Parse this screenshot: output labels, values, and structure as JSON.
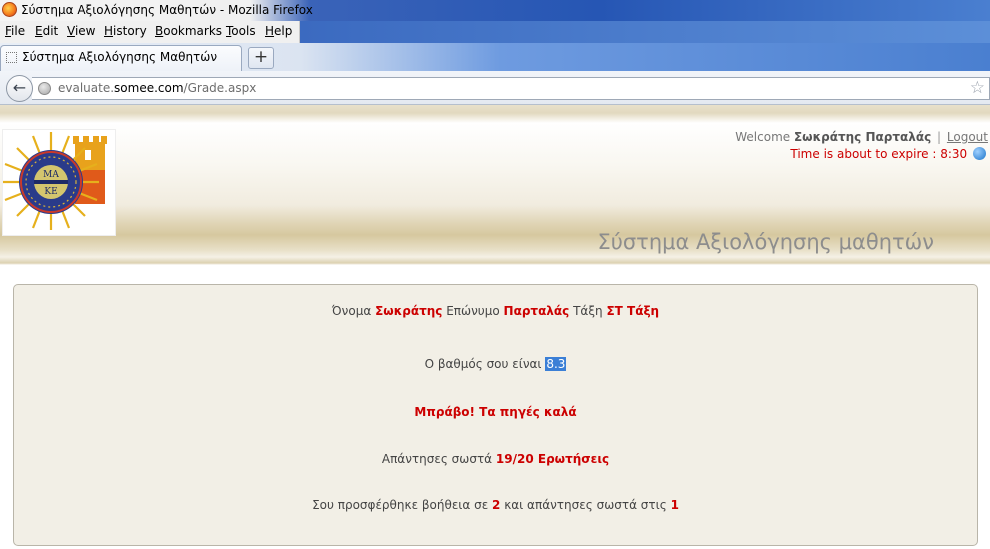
{
  "browser": {
    "window_title": "Σύστημα Αξιολόγησης Μαθητών - Mozilla Firefox",
    "menu": [
      "File",
      "Edit",
      "View",
      "History",
      "Bookmarks",
      "Tools",
      "Help"
    ],
    "tab_title": "Σύστημα Αξιολόγησης Μαθητών",
    "new_tab_symbol": "+",
    "url_prefix": "evaluate.",
    "url_domain": "somee.com",
    "url_path": "/Grade.aspx"
  },
  "header": {
    "welcome_label": "Welcome",
    "username": "Σωκράτης Παρταλάς",
    "separator": "|",
    "logout": "Logout",
    "expire_text": "Time is about to expire : 8:30",
    "site_title": "Σύστημα Αξιολόγησης μαθητών",
    "logo_text_top": "ΜΑ",
    "logo_text_bottom": "ΚΕ"
  },
  "result": {
    "name_label": "Όνομα",
    "first_name": "Σωκράτης",
    "surname_label": "Επώνυμο",
    "last_name": "Παρταλάς",
    "class_label": "Τάξη",
    "class_value": "ΣΤ Τάξη",
    "grade_label": "Ο βαθμός σου είναι",
    "grade_value": "8.3",
    "praise": "Μπράβο! Τα πηγές καλά",
    "correct_label": "Απάντησες σωστά",
    "correct_value": "19/20 Ερωτήσεις",
    "help_prefix": "Σου προσφέρθηκε βοήθεια σε",
    "help_count": "2",
    "help_middle": "και απάντησες σωστά στις",
    "help_correct": "1"
  },
  "colors": {
    "accent_red": "#cc0000",
    "panel_bg": "#f2efe6",
    "selection_blue": "#3b7fd6"
  }
}
